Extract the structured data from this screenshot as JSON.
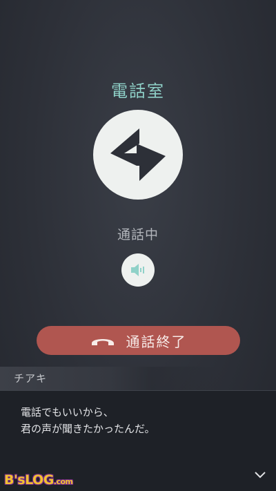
{
  "call": {
    "room_name": "電話室",
    "status": "通話中",
    "end_call_label": "通話終了"
  },
  "dialogue": {
    "speaker": "チアキ",
    "lines": [
      "電話でもいいから、",
      "君の声が聞きたかったんだ。"
    ]
  },
  "watermark": {
    "main": "B'sLOG",
    "suffix": ".com"
  },
  "icons": {
    "avatar": "app-logo-icon",
    "speaker": "speaker-volume-icon",
    "end_call": "phone-hangup-icon",
    "next": "chevron-down-icon"
  },
  "colors": {
    "accent": "#8fd1c8",
    "end_call": "#b05650",
    "background": "#2d3038"
  }
}
